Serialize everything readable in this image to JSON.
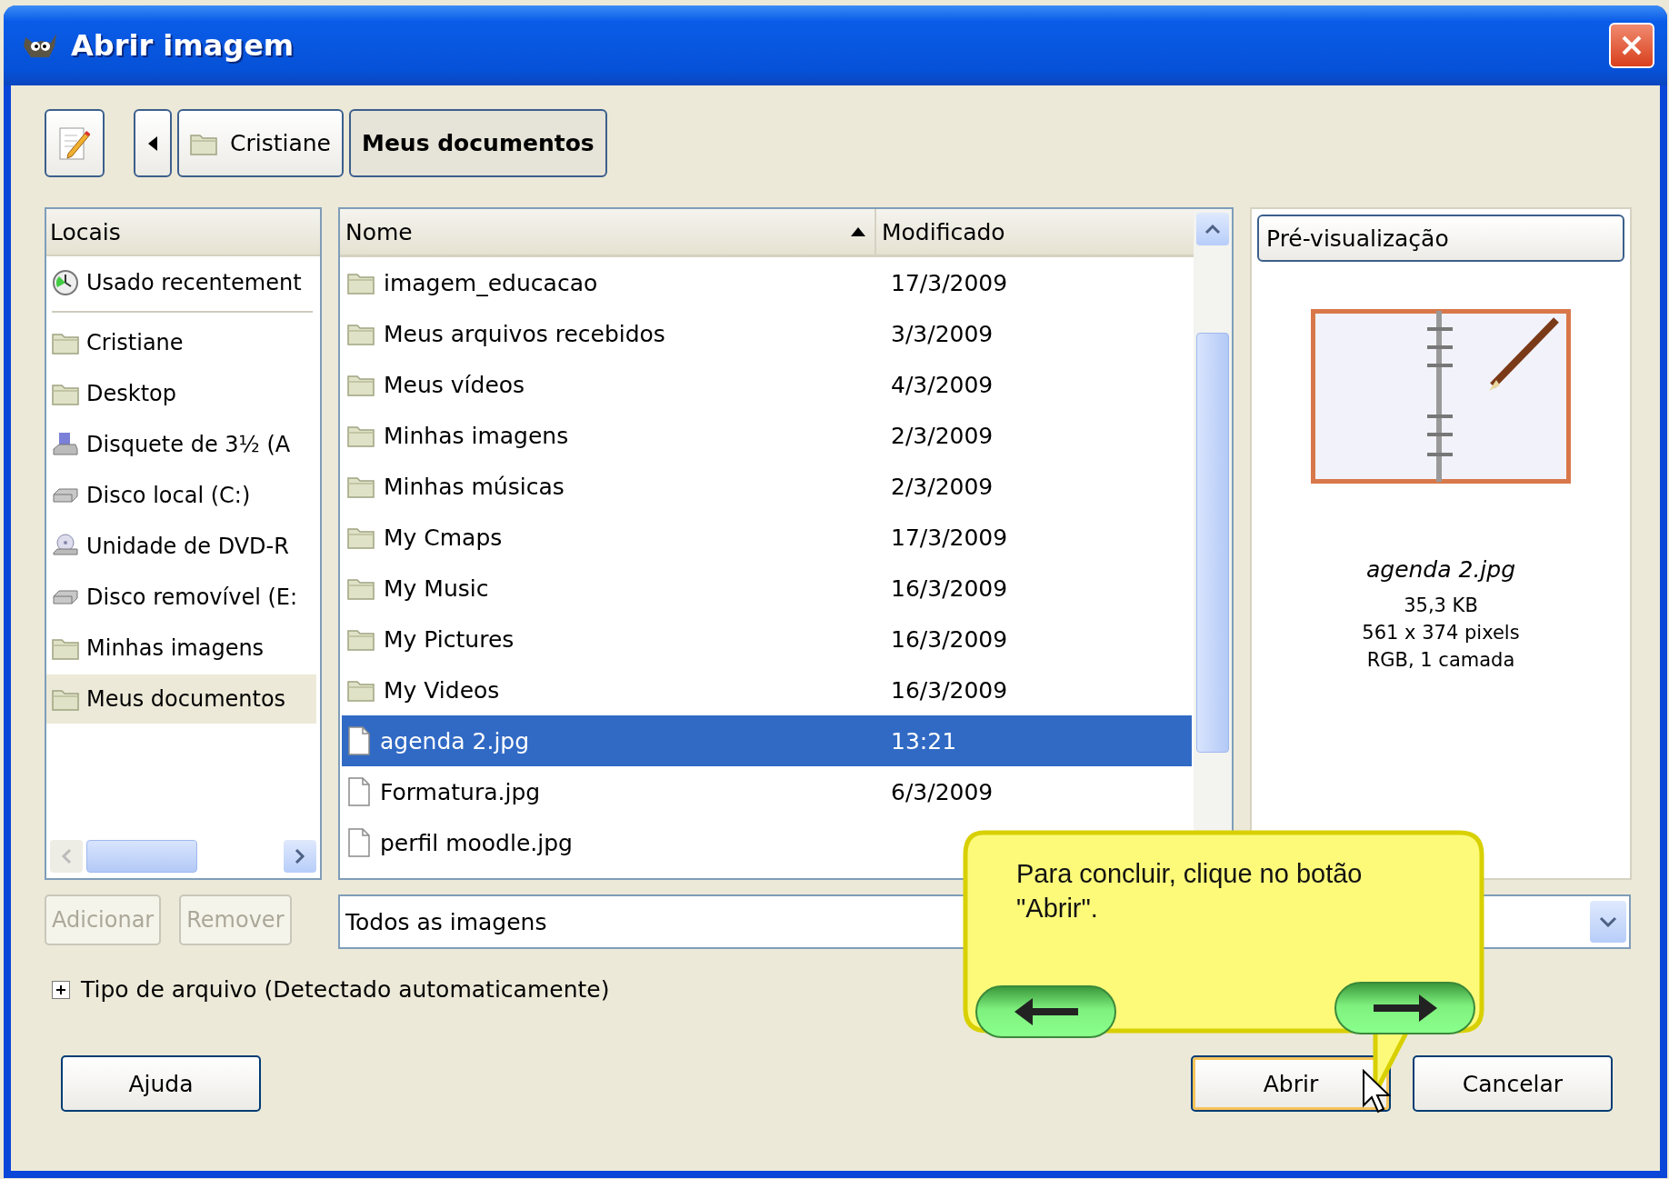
{
  "window": {
    "title": "Abrir imagem"
  },
  "path_bar": {
    "segments": [
      {
        "label": "Cristiane",
        "selected": false,
        "kind": "folder"
      },
      {
        "label": "Meus documentos",
        "selected": true,
        "kind": "text"
      }
    ]
  },
  "places": {
    "header": "Locais",
    "items": [
      {
        "label": "Usado recentement",
        "kind": "recent",
        "selected": false
      },
      {
        "label": "Cristiane",
        "kind": "folder",
        "selected": false
      },
      {
        "label": "Desktop",
        "kind": "folder",
        "selected": false
      },
      {
        "label": "Disquete de 3½ (A",
        "kind": "floppy",
        "selected": false
      },
      {
        "label": "Disco local (C:)",
        "kind": "disk",
        "selected": false
      },
      {
        "label": "Unidade de DVD-R",
        "kind": "dvd",
        "selected": false
      },
      {
        "label": "Disco removível (E:",
        "kind": "disk",
        "selected": false
      },
      {
        "label": "Minhas imagens",
        "kind": "folder",
        "selected": false
      },
      {
        "label": "Meus documentos",
        "kind": "folder",
        "selected": true
      }
    ]
  },
  "files": {
    "columns": [
      "Nome",
      "Modificado"
    ],
    "rows": [
      {
        "name": "imagem_educacao",
        "modified": "17/3/2009",
        "kind": "folder",
        "selected": false
      },
      {
        "name": "Meus arquivos recebidos",
        "modified": "3/3/2009",
        "kind": "folder",
        "selected": false
      },
      {
        "name": "Meus vídeos",
        "modified": "4/3/2009",
        "kind": "folder",
        "selected": false
      },
      {
        "name": "Minhas imagens",
        "modified": "2/3/2009",
        "kind": "folder",
        "selected": false
      },
      {
        "name": "Minhas músicas",
        "modified": "2/3/2009",
        "kind": "folder",
        "selected": false
      },
      {
        "name": "My Cmaps",
        "modified": "17/3/2009",
        "kind": "folder",
        "selected": false
      },
      {
        "name": "My Music",
        "modified": "16/3/2009",
        "kind": "folder",
        "selected": false
      },
      {
        "name": "My Pictures",
        "modified": "16/3/2009",
        "kind": "folder",
        "selected": false
      },
      {
        "name": "My Videos",
        "modified": "16/3/2009",
        "kind": "folder",
        "selected": false
      },
      {
        "name": "agenda 2.jpg",
        "modified": "13:21",
        "kind": "file",
        "selected": true
      },
      {
        "name": "Formatura.jpg",
        "modified": "6/3/2009",
        "kind": "file",
        "selected": false
      },
      {
        "name": "perfil moodle.jpg",
        "modified": "",
        "kind": "file",
        "selected": false
      }
    ]
  },
  "preview": {
    "title": "Pré-visualização",
    "file_name": "agenda 2.jpg",
    "details": [
      "35,3 KB",
      "561 x 374 pixels",
      "RGB, 1 camada"
    ]
  },
  "place_buttons": [
    {
      "label": "Adicionar",
      "disabled": true
    },
    {
      "label": "Remover",
      "disabled": true
    }
  ],
  "filter": {
    "value": "Todos as imagens"
  },
  "file_type": {
    "label": "Tipo de arquivo (Detectado automaticamente)",
    "expanded": false
  },
  "actions": [
    {
      "label": "Ajuda",
      "default": false
    },
    {
      "label": "Abrir",
      "default": true
    },
    {
      "label": "Cancelar",
      "default": false
    }
  ],
  "callout": {
    "text": "Para concluir, clique no botão \"Abrir\"."
  }
}
